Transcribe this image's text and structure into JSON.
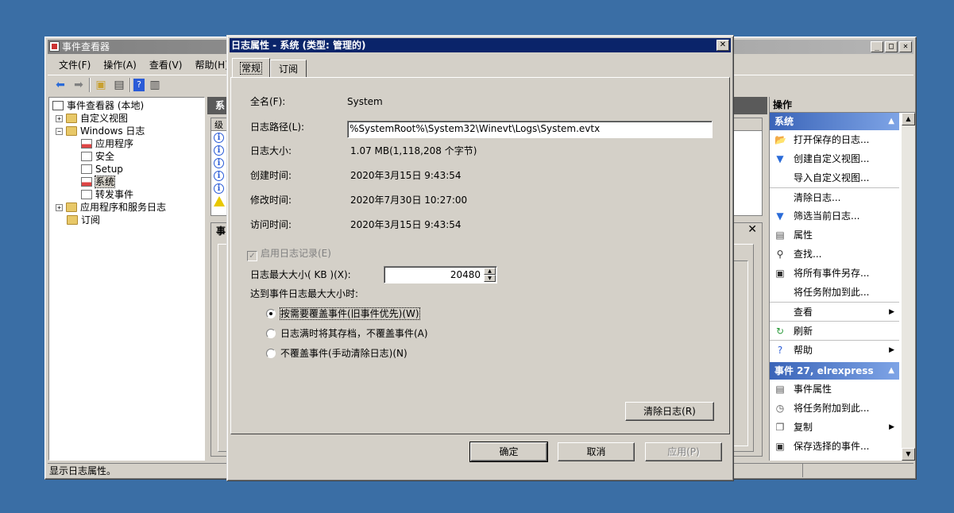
{
  "main_window": {
    "title": "事件查看器",
    "menu": [
      "文件(F)",
      "操作(A)",
      "查看(V)",
      "帮助(H)"
    ],
    "controls": {
      "minimize": "_",
      "maximize": "□",
      "close": "✕"
    }
  },
  "tree": {
    "root": "事件查看器 (本地)",
    "custom_views": "自定义视图",
    "windows_logs": "Windows 日志",
    "application": "应用程序",
    "security": "安全",
    "setup": "Setup",
    "system": "系统",
    "forwarded": "转发事件",
    "app_service_logs": "应用程序和服务日志",
    "subscriptions": "订阅"
  },
  "middle": {
    "header": "系",
    "col_level": "级",
    "detail_header": "事",
    "detail_close": "✕"
  },
  "actions": {
    "header": "操作",
    "section1": "系统",
    "items1": [
      {
        "label": "打开保存的日志...",
        "icon": "open-folder"
      },
      {
        "label": "创建自定义视图...",
        "icon": "filter"
      },
      {
        "label": "导入自定义视图...",
        "icon": ""
      },
      {
        "label": "清除日志...",
        "icon": ""
      },
      {
        "label": "筛选当前日志...",
        "icon": "filter"
      },
      {
        "label": "属性",
        "icon": "properties"
      },
      {
        "label": "查找...",
        "icon": "binoculars"
      },
      {
        "label": "将所有事件另存...",
        "icon": "save"
      },
      {
        "label": "将任务附加到此...",
        "icon": ""
      },
      {
        "label": "查看",
        "icon": "",
        "submenu": true
      },
      {
        "label": "刷新",
        "icon": "refresh"
      },
      {
        "label": "帮助",
        "icon": "help",
        "submenu": true
      }
    ],
    "section2": "事件 27, elrexpress",
    "items2": [
      {
        "label": "事件属性",
        "icon": "properties"
      },
      {
        "label": "将任务附加到此...",
        "icon": "task"
      },
      {
        "label": "复制",
        "icon": "copy",
        "submenu": true
      },
      {
        "label": "保存选择的事件...",
        "icon": "save"
      }
    ]
  },
  "status_bar": "显示日志属性。",
  "dialog": {
    "title": "日志属性 - 系统 (类型: 管理的)",
    "close": "✕",
    "tabs": [
      "常规",
      "订阅"
    ],
    "full_name_label": "全名(F):",
    "full_name": "System",
    "log_path_label": "日志路径(L):",
    "log_path": "%SystemRoot%\\System32\\Winevt\\Logs\\System.evtx",
    "log_size_label": "日志大小:",
    "log_size": "1.07 MB(1,118,208 个字节)",
    "created_label": "创建时间:",
    "created": "2020年3月15日 9:43:54",
    "modified_label": "修改时间:",
    "modified": "2020年7月30日 10:27:00",
    "accessed_label": "访问时间:",
    "accessed": "2020年3月15日 9:43:54",
    "enable_logging": "启用日志记录(E)",
    "max_size_label": "日志最大大小( KB )(X):",
    "max_size": "20480",
    "when_max_label": "达到事件日志最大大小时:",
    "radio_overwrite": "按需要覆盖事件(旧事件优先)(W)",
    "radio_archive": "日志满时将其存档，不覆盖事件(A)",
    "radio_no_overwrite": "不覆盖事件(手动清除日志)(N)",
    "clear_log": "清除日志(R)",
    "ok": "确定",
    "cancel": "取消",
    "apply": "应用(P)"
  }
}
